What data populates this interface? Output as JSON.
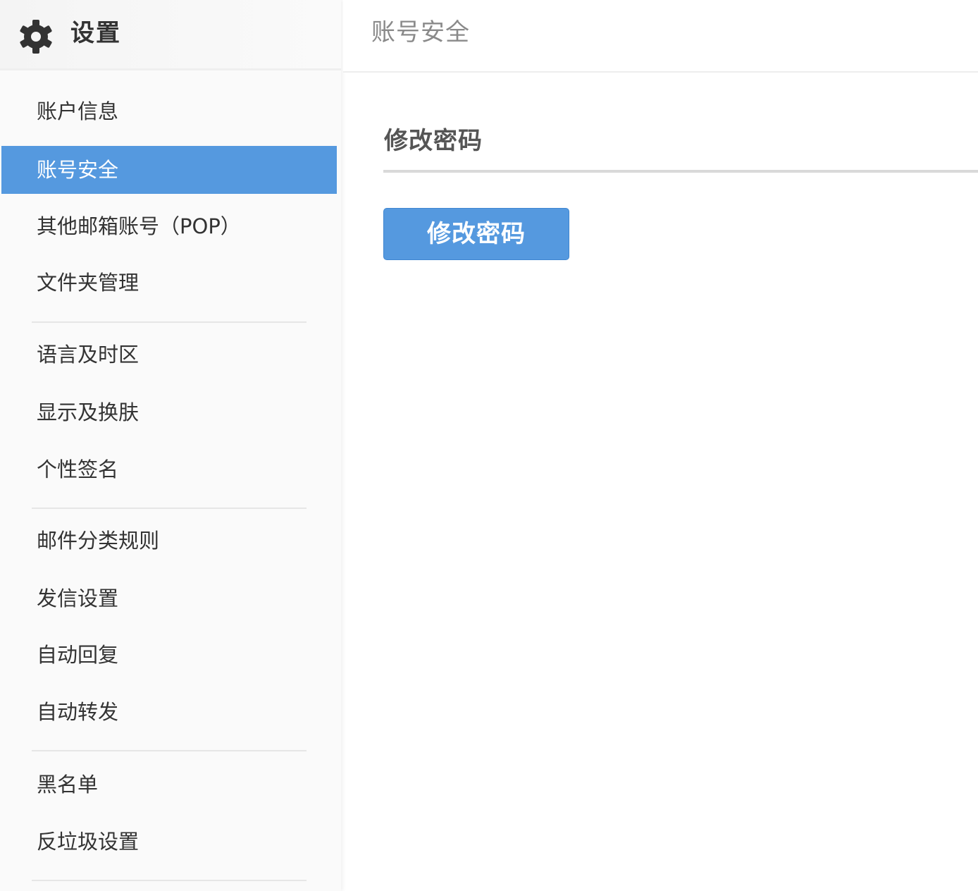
{
  "sidebar": {
    "title": "设置",
    "items": [
      {
        "label": "账户信息",
        "active": false
      },
      {
        "label": "账号安全",
        "active": true
      },
      {
        "label": "其他邮箱账号（POP）",
        "active": false
      },
      {
        "label": "文件夹管理",
        "active": false
      },
      {
        "label": "语言及时区",
        "active": false
      },
      {
        "label": "显示及换肤",
        "active": false
      },
      {
        "label": "个性签名",
        "active": false
      },
      {
        "label": "邮件分类规则",
        "active": false
      },
      {
        "label": "发信设置",
        "active": false
      },
      {
        "label": "自动回复",
        "active": false
      },
      {
        "label": "自动转发",
        "active": false
      },
      {
        "label": "黑名单",
        "active": false
      },
      {
        "label": "反垃圾设置",
        "active": false
      }
    ]
  },
  "main": {
    "page_title": "账号安全",
    "section_title": "修改密码",
    "button_label": "修改密码"
  },
  "colors": {
    "accent": "#5599df",
    "sidebar_bg": "#fafafa",
    "text": "#333333"
  },
  "icons": {
    "settings": "gear-icon"
  }
}
